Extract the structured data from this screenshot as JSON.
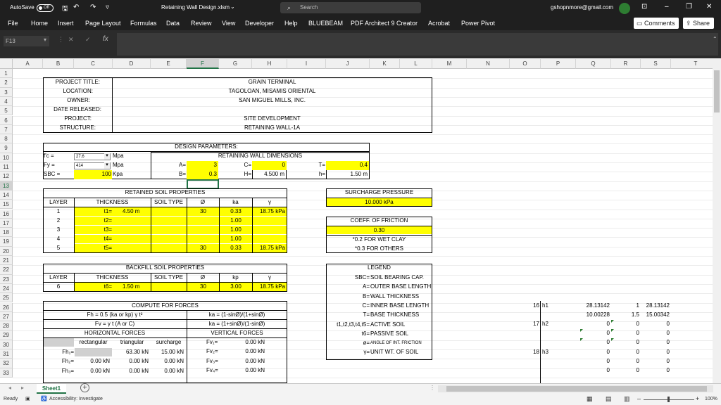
{
  "titlebar": {
    "autosave_label": "AutoSave",
    "autosave_state": "Off",
    "filename": "Retaining Wall Design.xlsm",
    "search_placeholder": "Search",
    "account": "gshopnmore@gmail.com"
  },
  "ribbon": {
    "tabs": [
      "File",
      "Home",
      "Insert",
      "Page Layout",
      "Formulas",
      "Data",
      "Review",
      "View",
      "Developer",
      "Help",
      "BLUEBEAM",
      "PDF Architect 9 Creator",
      "Acrobat",
      "Power Pivot"
    ],
    "comments": "Comments",
    "share": "Share"
  },
  "formula": {
    "namebox": "F13",
    "fx": "fx"
  },
  "columns": [
    "A",
    "B",
    "C",
    "D",
    "E",
    "F",
    "G",
    "H",
    "I",
    "J",
    "K",
    "L",
    "M",
    "N",
    "O",
    "P",
    "Q",
    "R",
    "S",
    "T"
  ],
  "rows": [
    "1",
    "2",
    "3",
    "4",
    "5",
    "6",
    "7",
    "8",
    "9",
    "10",
    "11",
    "12",
    "13",
    "14",
    "15",
    "16",
    "17",
    "18",
    "19",
    "20",
    "21",
    "22",
    "23",
    "24",
    "25",
    "26",
    "27",
    "28",
    "29",
    "30",
    "31",
    "32",
    "33"
  ],
  "project": {
    "labels": [
      "PROJECT TITLE:",
      "LOCATION:",
      "OWNER:",
      "DATE RELEASED:",
      "PROJECT:",
      "STRUCTURE:"
    ],
    "values": [
      "GRAIN TERMINAL",
      "TAGOLOAN, MISAMIS ORIENTAL",
      "SAN MIGUEL MILLS, INC.",
      "",
      "SITE DEVELOPMENT",
      "RETAINING WALL-1A"
    ]
  },
  "design": {
    "title": "DESIGN PARAMETERS:",
    "fc_label": "f'c =",
    "fc": "27.6",
    "fc_unit": "Mpa",
    "fy_label": "Fy =",
    "fy": "414",
    "fy_unit": "Mpa",
    "sbc_label": "SBC =",
    "sbc": "100",
    "sbc_unit": "Kpa",
    "dims_title": "RETAINING WALL DIMENSIONS",
    "a_label": "A=",
    "a": "3",
    "c_label": "C=",
    "c": "0",
    "t_label": "T=",
    "t": "0.4",
    "b_label": "B=",
    "b": "0.3",
    "h_label": "H=",
    "h": "4.500 m",
    "hh_label": "h=",
    "hh": "1.50 m"
  },
  "retained": {
    "title": "RETAINED SOIL PROPERTIES",
    "headers": [
      "LAYER",
      "THICKNESS",
      "SOIL TYPE",
      "Ø",
      "ka",
      "γ"
    ],
    "rows": [
      {
        "layer": "1",
        "t": "t1=",
        "val": "4.50 m",
        "phi": "30",
        "ka": "0.33",
        "g": "18.75 kPa"
      },
      {
        "layer": "2",
        "t": "t2=",
        "val": "",
        "phi": "",
        "ka": "1.00",
        "g": ""
      },
      {
        "layer": "3",
        "t": "t3=",
        "val": "",
        "phi": "",
        "ka": "1.00",
        "g": ""
      },
      {
        "layer": "4",
        "t": "t4=",
        "val": "",
        "phi": "",
        "ka": "1.00",
        "g": ""
      },
      {
        "layer": "5",
        "t": "t5=",
        "val": "",
        "phi": "30",
        "ka": "0.33",
        "g": "18.75 kPa"
      }
    ]
  },
  "surcharge": {
    "title": "SURCHARGE PRESSURE",
    "value": "10.000 kPa"
  },
  "friction": {
    "title": "COEFF. OF FRICTION",
    "value": "0.30",
    "note1": "*0.2 FOR WET CLAY",
    "note2": "*0.3 FOR OTHERS"
  },
  "backfill": {
    "title": "BACKFILL SOIL PROPERTIES",
    "headers": [
      "LAYER",
      "THICKNESS",
      "SOIL TYPE",
      "Ø",
      "kp",
      "γ"
    ],
    "row": {
      "layer": "6",
      "t": "t6=",
      "val": "1.50 m",
      "phi": "30",
      "kp": "3.00",
      "g": "18.75 kPa"
    }
  },
  "legend": {
    "title": "LEGEND",
    "items": [
      [
        "SBC=",
        "SOIL BEARING CAP."
      ],
      [
        "A=",
        "OUTER BASE LENGTH"
      ],
      [
        "B=",
        "WALL THICKNESS"
      ],
      [
        "C=",
        "INNER BASE LENGTH"
      ],
      [
        "T=",
        "BASE THICKNESS"
      ],
      [
        "t1,t2,t3,t4,t5=",
        "ACTIVE SOIL"
      ],
      [
        "t6=",
        "PASSIVE SOIL"
      ],
      [
        "ø=",
        "ANGLE OF INT. FRICTION"
      ],
      [
        "γ=",
        "UNIT WT. OF SOIL"
      ]
    ]
  },
  "forces": {
    "title": "COMPUTE FOR FORCES",
    "f1": "Fh = 0.5 (ka or kp) γ t²",
    "f2": "Fv = γ t (A or C)",
    "f3": "ka = (1-sinØ)/(1+sinØ)",
    "f4": "ka = (1+sinØ)/(1-sinØ)",
    "horiz": "HORIZONTAL FORCES",
    "vert": "VERTICAL FORCES",
    "sub": [
      "rectangular",
      "triangular",
      "surcharge"
    ],
    "fh": [
      {
        "l": "Fh₁=",
        "r": "",
        "t": "63.30 kN",
        "s": "15.00 kN"
      },
      {
        "l": "Fh₂=",
        "r": "0.00 kN",
        "t": "0.00 kN",
        "s": "0.00 kN"
      },
      {
        "l": "Fh₃=",
        "r": "0.00 kN",
        "t": "0.00 kN",
        "s": "0.00 kN"
      }
    ],
    "fv": [
      {
        "l": "Fv₁=",
        "v": "0.00 kN"
      },
      {
        "l": "Fv₂=",
        "v": "0.00 kN"
      },
      {
        "l": "Fv₃=",
        "v": "0.00 kN"
      },
      {
        "l": "Fv₄=",
        "v": "0.00 kN"
      }
    ]
  },
  "side": {
    "r26": [
      "16",
      "h1",
      "28.13142",
      "1",
      "28.13142"
    ],
    "r27": [
      "10.00228",
      "1.5",
      "15.00342"
    ],
    "r28": [
      "17",
      "h2",
      "0",
      "0",
      "0"
    ],
    "r29": [
      "0",
      "0",
      "0"
    ],
    "r30": [
      "0",
      "0",
      "0"
    ],
    "r31": [
      "18",
      "h3",
      "0",
      "0",
      "0"
    ],
    "r32": [
      "0",
      "0",
      "0"
    ],
    "r33": [
      "0",
      "0",
      "0"
    ]
  },
  "sheet": {
    "tab": "Sheet1",
    "add": "+"
  },
  "status": {
    "ready": "Ready",
    "accessibility": "Accessibility: Investigate",
    "zoom": "100%"
  }
}
